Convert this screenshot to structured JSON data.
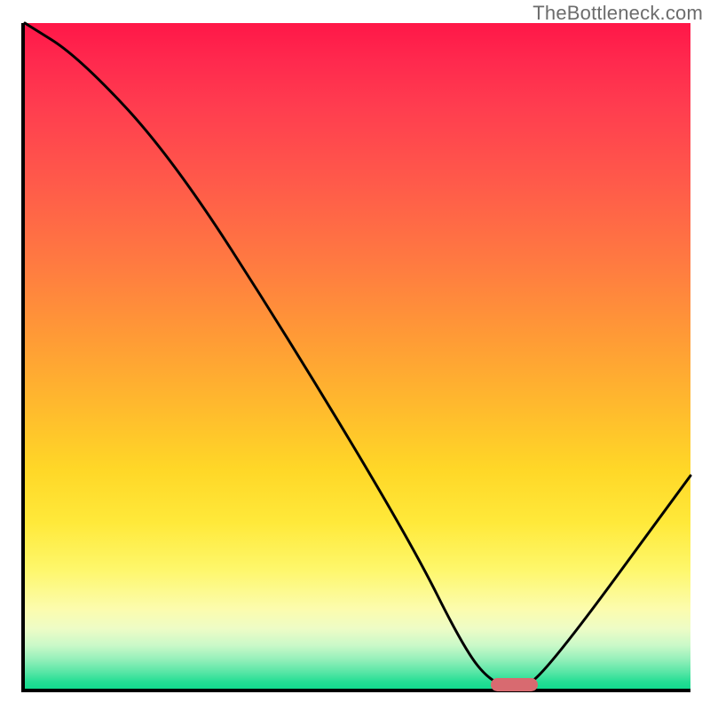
{
  "attribution": "TheBottleneck.com",
  "colors": {
    "gradient_top": "#ff1748",
    "gradient_bottom": "#13db8e",
    "curve": "#000000",
    "marker": "#d86a70",
    "axis": "#000000"
  },
  "chart_data": {
    "type": "line",
    "title": "",
    "xlabel": "",
    "ylabel": "",
    "xlim": [
      0,
      100
    ],
    "ylim": [
      0,
      100
    ],
    "grid": false,
    "legend": false,
    "background": "heatmap-gradient red→yellow→green (bottleneck severity)",
    "series": [
      {
        "name": "bottleneck-curve",
        "x": [
          0,
          8,
          22,
          40,
          58,
          66,
          70,
          74,
          78,
          100
        ],
        "values": [
          100,
          95,
          80,
          52,
          22,
          6,
          1,
          0,
          2,
          32
        ]
      }
    ],
    "annotations": [
      {
        "name": "optimum-marker",
        "shape": "rounded-bar",
        "x_range": [
          70,
          77
        ],
        "y": 0.7,
        "color": "#d86a70"
      }
    ]
  }
}
